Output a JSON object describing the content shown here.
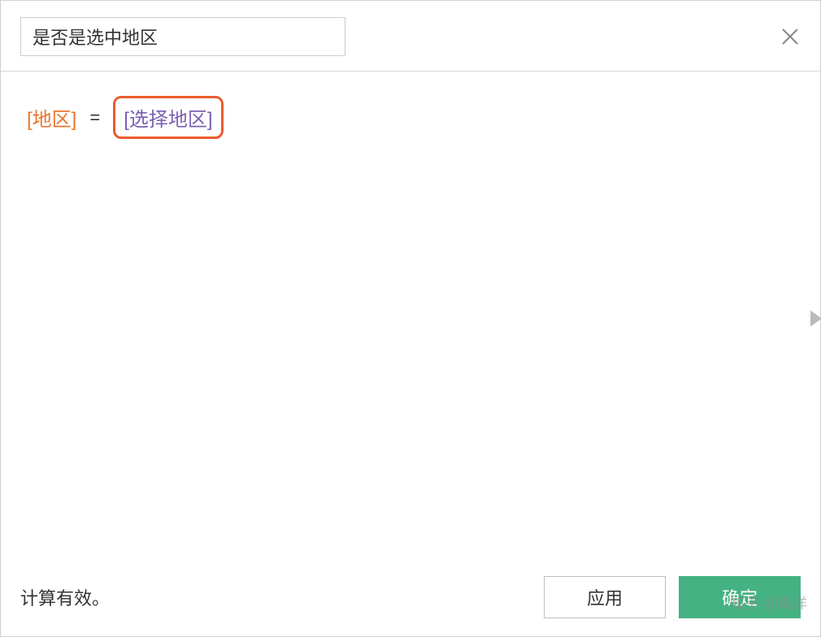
{
  "header": {
    "title_value": "是否是选中地区"
  },
  "formula": {
    "left_token": "[地区]",
    "operator": "=",
    "right_token": "[选择地区]"
  },
  "footer": {
    "status_text": "计算有效。",
    "apply_label": "应用",
    "confirm_label": "确定"
  },
  "watermark": "知乎 @禹洋",
  "colors": {
    "accent_orange": "#e8762c",
    "accent_purple": "#7b5fb3",
    "highlight_border": "#eb5b2e",
    "confirm_green": "#45b283"
  }
}
